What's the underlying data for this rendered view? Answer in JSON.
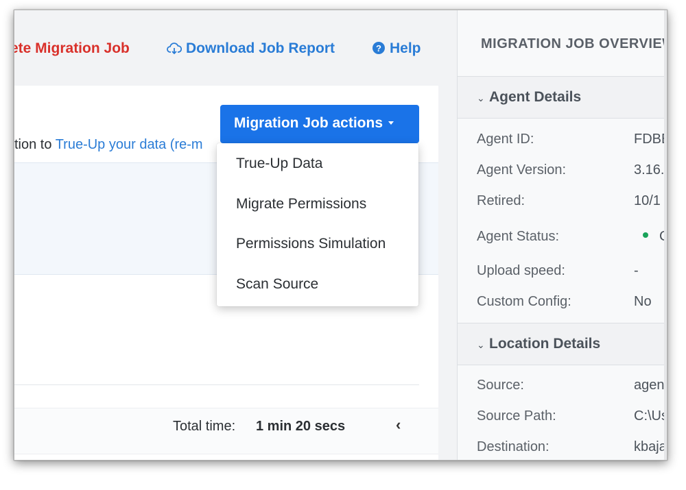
{
  "toolbar": {
    "delete_label": "ete Migration Job",
    "download_label": "Download Job Report",
    "help_label": "Help"
  },
  "actions": {
    "button_label": "Migration Job actions",
    "menu": [
      "True-Up Data",
      "Migrate Permissions",
      "Permissions Simulation",
      "Scan Source"
    ]
  },
  "main": {
    "info_prefix": "tion to ",
    "info_link": "True-Up your data (re-m",
    "total_label": "Total time:",
    "total_value": "1 min 20 secs"
  },
  "panel": {
    "title": "MIGRATION JOB OVERVIEW",
    "agent_section": "Agent Details",
    "agent_rows": [
      {
        "label": "Agent ID:",
        "value": "FDBE"
      },
      {
        "label": "Agent Version:",
        "value": "3.16."
      },
      {
        "label": "Retired:",
        "value": "10/1"
      },
      {
        "label": "Agent Status:",
        "value": "C"
      },
      {
        "label": "Upload speed:",
        "value": "-"
      },
      {
        "label": "Custom Config:",
        "value": "No"
      }
    ],
    "location_section": "Location Details",
    "location_rows": [
      {
        "label": "Source:",
        "value": "agen"
      },
      {
        "label": "Source Path:",
        "value": "C:\\Us"
      },
      {
        "label": "Destination:",
        "value": "kbaja"
      }
    ]
  },
  "colors": {
    "primary": "#1a73e8",
    "danger": "#d9302a",
    "link": "#2a7cd6",
    "status_online": "#1aa35a"
  }
}
